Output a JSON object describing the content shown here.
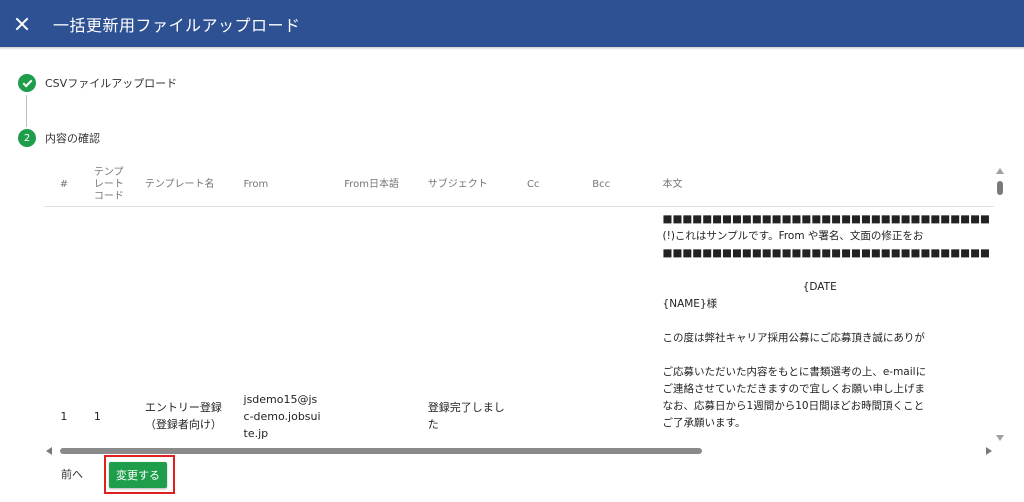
{
  "header": {
    "title": "一括更新用ファイルアップロード"
  },
  "steps": [
    {
      "number": "",
      "label": "CSVファイルアップロード",
      "status": "completed"
    },
    {
      "number": "2",
      "label": "内容の確認",
      "status": "active"
    }
  ],
  "table": {
    "columns": [
      "#",
      "テンプ\nレート\nコード",
      "テンプレート名",
      "From",
      "From日本語",
      "サブジェクト",
      "Cc",
      "Bcc",
      "本文"
    ],
    "rows": [
      {
        "no": "1",
        "code": "1",
        "name": "エントリー登録\n（登録者向け）",
        "from": "jsdemo15@js\nc-demo.jobsui\nte.jp",
        "from_jp": "",
        "subject": "登録完了しまし\nた",
        "cc": "",
        "bcc": "",
        "body": "■■■■■■■■■■■■■■■■■■■■■■■■■■■■■■■■■\n(!)これはサンプルです。From や署名、文面の修正をお\n■■■■■■■■■■■■■■■■■■■■■■■■■■■■■■■■■\n\n                                          {DATE\n{NAME}様\n\nこの度は弊社キャリア採用公募にご応募頂き誠にありが\n\nご応募いただいた内容をもとに書類選考の上、e-mailに\nご連絡させていただきますので宜しくお願い申し上げま\nなお、応募日から1週間から10日間ほどお時間頂くこと\nご了承願います。\n\n{NAME}様の ID は下記の通りとなります。"
      }
    ]
  },
  "footer": {
    "back_label": "前へ",
    "submit_label": "変更する"
  },
  "colors": {
    "header": "#2e5193",
    "accent_green": "#1e9e4a",
    "highlight": "#e02020"
  }
}
